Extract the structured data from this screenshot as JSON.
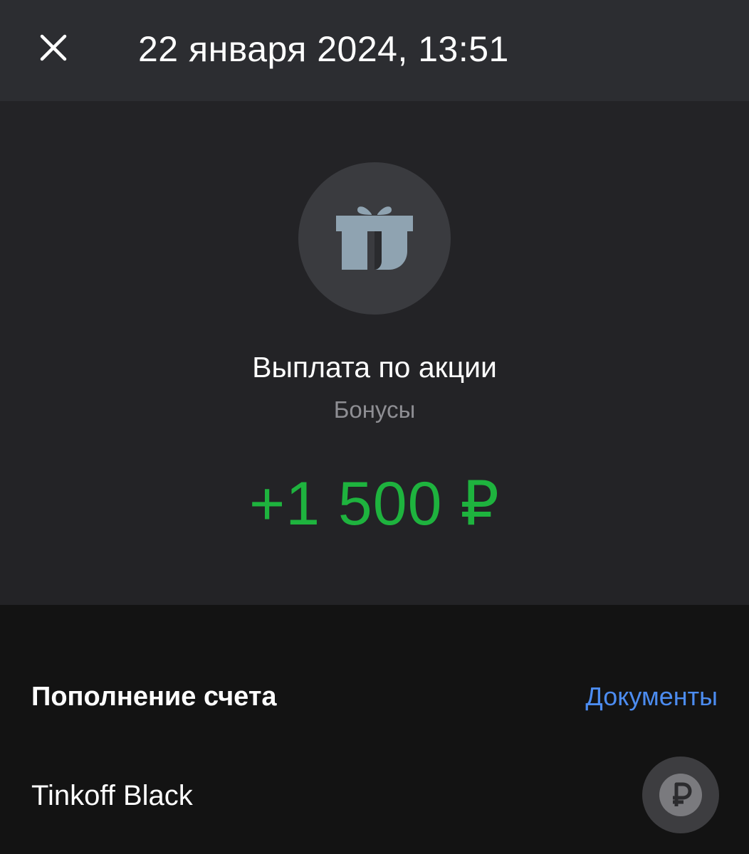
{
  "header": {
    "title": "22 января 2024, 13:51",
    "close_icon": "close-icon"
  },
  "operation": {
    "icon": "gift-icon",
    "title": "Выплата по акции",
    "category": "Бонусы",
    "amount": "+1 500 ₽",
    "amount_color": "#1eb33e"
  },
  "details": {
    "section_title": "Пополнение счета",
    "documents_label": "Документы",
    "documents_color": "#4c8cf0",
    "account": {
      "name": "Tinkoff Black",
      "icon": "ruble-icon"
    }
  },
  "colors": {
    "header_bg": "#2c2d31",
    "hero_bg": "#232326",
    "page_bg": "#131313",
    "icon_circle_bg": "#3a3b3f",
    "gift_color": "#8fa3b1"
  }
}
